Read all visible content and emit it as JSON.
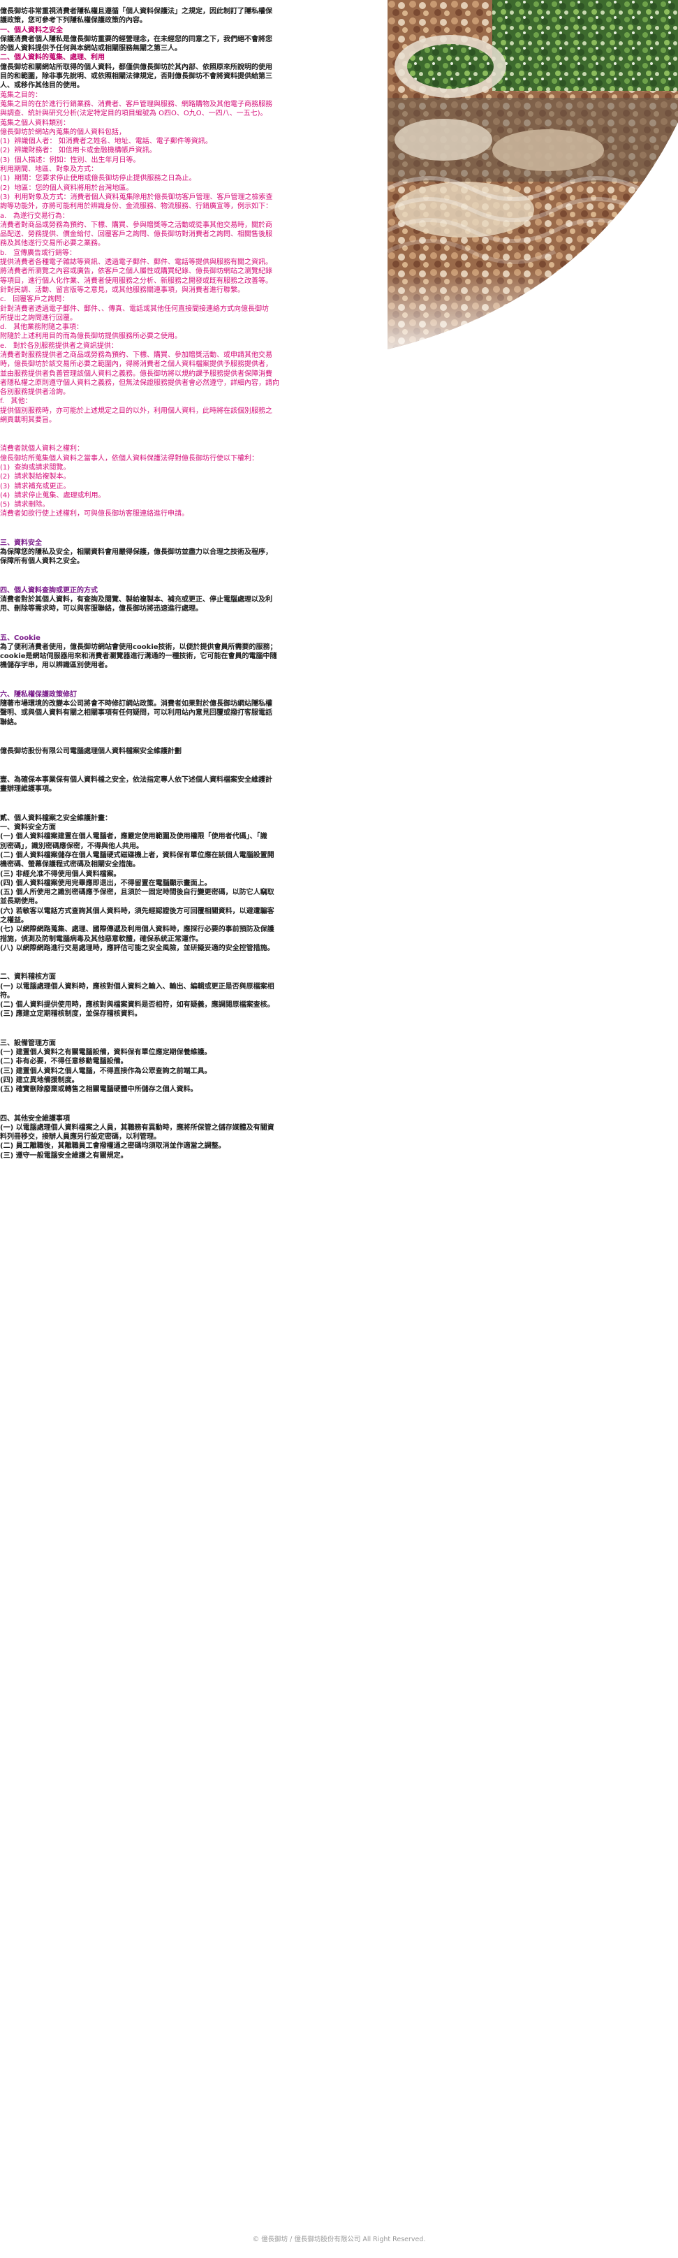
{
  "lines": [
    {
      "c": "b",
      "t": "億長御坊非常重視消費者隱私權且遵循「個人資料保護法」之規定，因此制訂了隱私權保"
    },
    {
      "c": "b",
      "t": "護政策，您可參考下列隱私權保護政策的內容。"
    },
    {
      "c": "pkb",
      "t": "一、個人資料之安全"
    },
    {
      "c": "b",
      "t": "保護消費者個人隱私是億長御坊重要的經營理念，在未經您的同意之下，我們絕不會將您"
    },
    {
      "c": "b",
      "t": "的個人資料提供予任何與本網站或相關服務無關之第三人。"
    },
    {
      "c": "pkb",
      "t": "二、個人資料的蒐集、處理、利用"
    },
    {
      "c": "b",
      "t": "億長御坊和關網站所取得的個人資料，都僅供億長御坊於其內部、依照原來所說明的使用"
    },
    {
      "c": "b",
      "t": "目的和範圍，除非事先說明、或依照相關法律規定，否則億長御坊不會將資料提供給第三"
    },
    {
      "c": "b",
      "t": "人、或移作其他目的使用。"
    },
    {
      "c": "pk",
      "t": "蒐集之目的："
    },
    {
      "c": "pk",
      "t": "蒐集之目的在於進行行銷業務、消費者、客戶管理與服務、網路購物及其他電子商務服務"
    },
    {
      "c": "pk",
      "t": "與調查、統計與研究分析(法定特定目的項目編號為 O四O、O九O、一四八、一五七)。"
    },
    {
      "c": "pk",
      "t": "蒐集之個人資料類別："
    },
    {
      "c": "pk",
      "t": "億長御坊於網站內蒐集的個人資料包括，"
    },
    {
      "c": "pk",
      "t": "(1)  辨識個人者： 如消費者之姓名、地址、電話、電子郵件等資訊。"
    },
    {
      "c": "pk",
      "t": "(2)  辨識財務者： 如信用卡或金融機構帳戶資訊。"
    },
    {
      "c": "pk",
      "t": "(3)  個人描述：例如：性別、出生年月日等。"
    },
    {
      "c": "pk",
      "t": "利用期間、地區、對象及方式："
    },
    {
      "c": "pk",
      "t": "(1)  期間：您要求停止使用或億長御坊停止提供服務之日為止。"
    },
    {
      "c": "pk",
      "t": "(2)  地區：您的個人資料將用於台灣地區。"
    },
    {
      "c": "pk",
      "t": "(3)  利用對象及方式：消費者個人資料蒐集除用於億長御坊客戶管理、客戶管理之檢索查"
    },
    {
      "c": "pk",
      "t": "詢等功能外，亦將可能利用於辨識身份、金流服務、物流服務、行銷廣宣等，例示如下："
    },
    {
      "c": "pk",
      "t": "a.   為遂行交易行為："
    },
    {
      "c": "pk",
      "t": "消費者對商品或勞務為預約、下標、購買、參與贈獎等之活動或從事其他交易時，關於商"
    },
    {
      "c": "pk",
      "t": "品配送、勞務提供、價金給付、回覆客戶之詢問、億長御坊對消費者之詢問、相關售後服"
    },
    {
      "c": "pk",
      "t": "務及其他遂行交易所必要之業務。"
    },
    {
      "c": "pk",
      "t": "b.   宣傳廣告或行銷等："
    },
    {
      "c": "pk",
      "t": "提供消費者各種電子雜誌等資訊、透過電子郵件、郵件、電話等提供與服務有關之資訊。"
    },
    {
      "c": "pk",
      "t": "將消費者所瀏覽之內容或廣告，依客戶之個人屬性或購買紀錄、億長御坊網站之瀏覽紀錄"
    },
    {
      "c": "pk",
      "t": "等項目，進行個人化作業、消費者使用服務之分析、新服務之開發或既有服務之改善等。"
    },
    {
      "c": "pk",
      "t": "針對民調、活動、留言版等之意見，或其他服務關連事項，與消費者進行聯繫。"
    },
    {
      "c": "pk",
      "t": "c.   回覆客戶之詢問："
    },
    {
      "c": "pk",
      "t": "針對消費者透過電子郵件、郵件、、傳真、電話或其他任何直接間接連絡方式向億長御坊"
    },
    {
      "c": "pk",
      "t": "所提出之詢問進行回覆。"
    },
    {
      "c": "pk",
      "t": "d.   其他業務附隨之事項："
    },
    {
      "c": "pk",
      "t": "附隨於上述利用目的而為億長御坊提供服務所必要之使用。"
    },
    {
      "c": "pk",
      "t": "e.   對於各別服務提供者之資訊提供："
    },
    {
      "c": "pk",
      "t": "消費者對服務提供者之商品或勞務為預約、下標、購買、參加贈獎活動、或申請其他交易"
    },
    {
      "c": "pk",
      "t": "時，億長御坊於該交易所必要之範圍內，得將消費者之個人資料檔案提供予服務提供者，"
    },
    {
      "c": "pk",
      "t": "並由服務提供者負善管理該個人資料之義務。億長御坊將以規約課予服務提供者保障消費"
    },
    {
      "c": "pk",
      "t": "者隱私權之原則遵守個人資料之義務，但無法保證服務提供者會必然遵守，詳細內容，請向"
    },
    {
      "c": "pk",
      "t": "各別服務提供者洽詢。"
    },
    {
      "c": "pk",
      "t": "f.   其他："
    },
    {
      "c": "pk",
      "t": "提供個別服務時，亦可能於上述規定之目的以外，利用個人資料，此時將在該個別服務之"
    },
    {
      "c": "pk",
      "t": "網頁載明其要旨。"
    },
    {
      "c": "gap2",
      "t": ""
    },
    {
      "c": "pk",
      "t": "消費者就個人資料之權利："
    },
    {
      "c": "pk",
      "t": "億長御坊所蒐集個人資料之當事人，依個人資料保護法得對億長御坊行使以下權利："
    },
    {
      "c": "pk",
      "t": "(1)  查詢或請求閱覽。"
    },
    {
      "c": "pk",
      "t": "(2)  請求製給複製本。"
    },
    {
      "c": "pk",
      "t": "(3)  請求補充或更正。"
    },
    {
      "c": "pk",
      "t": "(4)  請求停止蒐集、處理或利用。"
    },
    {
      "c": "pk",
      "t": "(5)  請求刪除。"
    },
    {
      "c": "pk",
      "t": "消費者如欲行使上述權利，可與億長御坊客服連絡進行申請。"
    },
    {
      "c": "gap2",
      "t": ""
    },
    {
      "c": "pb",
      "t": "三、資料安全"
    },
    {
      "c": "b",
      "t": "為保障您的隱私及安全，相關資料會用嚴得保護，億長御坊並盡力以合理之技術及程序，"
    },
    {
      "c": "b",
      "t": "保障所有個人資料之安全。"
    },
    {
      "c": "gap2",
      "t": ""
    },
    {
      "c": "pb",
      "t": "四、個人資料查詢或更正的方式"
    },
    {
      "c": "b",
      "t": "消費者對於其個人資料，有查詢及閱覽、製給複製本、補充或更正、停止電腦處理以及利"
    },
    {
      "c": "b",
      "t": "用、刪除等需求時，可以與客服聯絡，億長御坊將迅速進行處理。"
    },
    {
      "c": "gap2",
      "t": ""
    },
    {
      "c": "pb",
      "t": "五、Cookie"
    },
    {
      "c": "b",
      "t": "為了便利消費者使用，億長御坊網站會使用cookie技術，以便於提供會員所需要的服務；"
    },
    {
      "c": "b",
      "t": "cookie是網站伺服器用來和消費者瀏覽器進行溝通的一種技術，它可能在會員的電腦中隨"
    },
    {
      "c": "b",
      "t": "機儲存字串，用以辨識區別使用者。"
    },
    {
      "c": "gap2",
      "t": ""
    },
    {
      "c": "pb",
      "t": "六、隱私權保護政策修訂"
    },
    {
      "c": "b",
      "t": "隨著市場環境的改變本公司將會不時修訂網站政策。消費者如果對於億長御坊網站隱私權"
    },
    {
      "c": "b",
      "t": "聲明、或與個人資料有關之相關事項有任何疑問，可以利用站內意見回覆或撥打客服電話"
    },
    {
      "c": "b",
      "t": "聯絡。"
    },
    {
      "c": "gap2",
      "t": ""
    },
    {
      "c": "b",
      "t": "億長御坊股份有限公司電腦處理個人資料檔案安全維護計劃"
    },
    {
      "c": "gap2",
      "t": ""
    },
    {
      "c": "b",
      "t": "壹、為確保本事業保有個人資料檔之安全，依法指定專人依下述個人資料檔案安全維護計"
    },
    {
      "c": "b",
      "t": "畫辦理維護事項。"
    },
    {
      "c": "gap2",
      "t": ""
    },
    {
      "c": "b",
      "t": "貳、個人資料檔案之安全維護計畫："
    },
    {
      "c": "b",
      "t": "一、資料安全方面"
    },
    {
      "c": "b",
      "t": "(一) 個人資料檔案建置在個人電腦者，應嚴定使用範圍及使用權限「使用者代碼」、「識"
    },
    {
      "c": "b",
      "t": "別密碼」，識別密碼應保密，不得與他人共用。"
    },
    {
      "c": "b",
      "t": "(二) 個人資料檔案儲存在個人電腦硬式磁碟機上者，資料保有單位應在該個人電腦設置開"
    },
    {
      "c": "b",
      "t": "機密碼、螢幕保護程式密碼及相關安全措施。"
    },
    {
      "c": "b",
      "t": "(三) 非經允准不得使用個人資料檔案。"
    },
    {
      "c": "b",
      "t": "(四) 個人資料檔案使用完畢應即退出，不得留置在電腦顯示畫面上。"
    },
    {
      "c": "b",
      "t": "(五) 個人所使用之識別密碼應予保密，且須於一固定時間後自行變更密碼，以防它人竊取"
    },
    {
      "c": "b",
      "t": "並長期使用。"
    },
    {
      "c": "b",
      "t": "(六) 若敏客以電話方式查詢其個人資料時，須先經認證後方可回覆相關資料，以避遭騙客"
    },
    {
      "c": "b",
      "t": "之權益。"
    },
    {
      "c": "b",
      "t": "(七) 以網際網路蒐集、處理、國際傳遞及利用個人資料時，應採行必要的事前預防及保護"
    },
    {
      "c": "b",
      "t": "措施，偵測及防制電腦病毒及其他惡意軟體，確保系統正常運作。"
    },
    {
      "c": "b",
      "t": "(八) 以網際網路進行交易處理時，應評估可能之安全風險，並研擬妥適的安全控管措施。"
    },
    {
      "c": "gap2",
      "t": ""
    },
    {
      "c": "b",
      "t": "二、資料稽核方面"
    },
    {
      "c": "b",
      "t": "(一) 以電腦處理個人資料時，應核對個人資料之輸入、輸出、編輯或更正是否與原檔案相"
    },
    {
      "c": "b",
      "t": "符。"
    },
    {
      "c": "b",
      "t": "(二) 個人資料提供使用時，應核對與檔案資料是否相符，如有疑義，應調閱原檔案查核。"
    },
    {
      "c": "b",
      "t": "(三) 應建立定期稽核制度，並保存稽核資料。"
    },
    {
      "c": "gap2",
      "t": ""
    },
    {
      "c": "b",
      "t": "三、設備管理方面"
    },
    {
      "c": "b",
      "t": "(一) 建置個人資料之有關電腦設備，資料保有單位應定期保養維護。"
    },
    {
      "c": "b",
      "t": "(二) 非有必要，不得任意移動電腦設備。"
    },
    {
      "c": "b",
      "t": "(三) 建置個人資料之個人電腦，不得直接作為公眾查詢之前端工具。"
    },
    {
      "c": "b",
      "t": "(四) 建立異地備援制度。"
    },
    {
      "c": "b",
      "t": "(五) 確實刪除廢棄或轉售之相關電腦硬體中所儲存之個人資料。"
    },
    {
      "c": "gap2",
      "t": ""
    },
    {
      "c": "b",
      "t": "四、其他安全維護事項"
    },
    {
      "c": "b",
      "t": "(一) 以電腦處理個人資料檔案之人員，其職務有異動時，應將所保管之儲存媒體及有關資"
    },
    {
      "c": "b",
      "t": "料列冊移交，接辦人員應另行設定密碼，以利管理。"
    },
    {
      "c": "b",
      "t": "(二) 員工離職後，其離職員工會撥權通之密碼均須取消並作適當之調整。"
    },
    {
      "c": "b",
      "t": "(三) 遵守一般電腦安全維護之有關規定。"
    }
  ],
  "footer": "© 億長御坊 / 億長御坊股份有限公司 All Right Reserved."
}
